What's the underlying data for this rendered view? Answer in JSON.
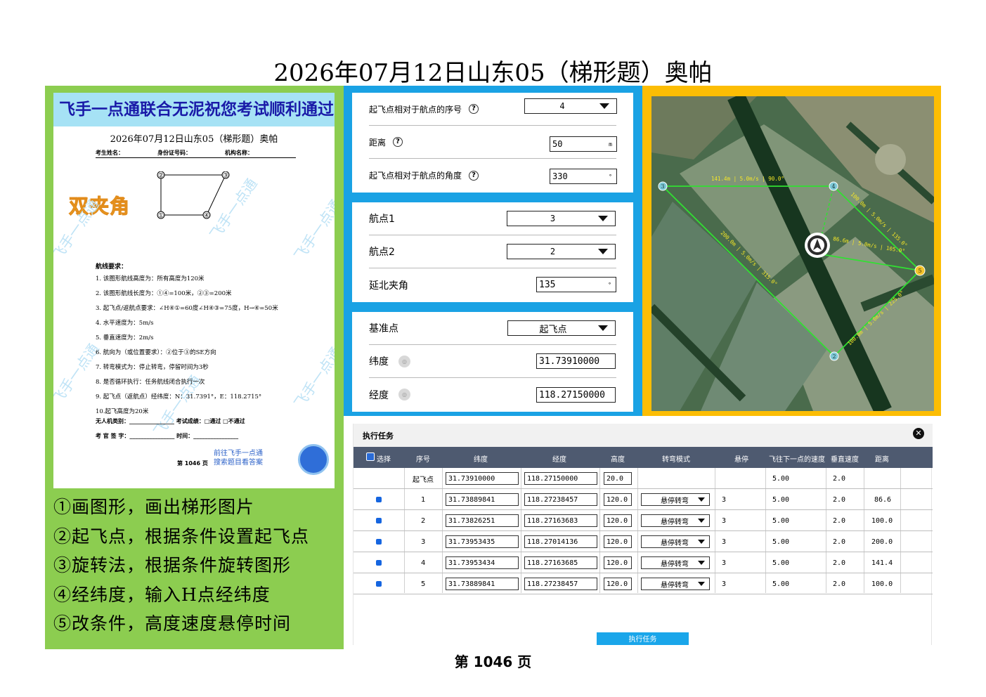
{
  "page_title": "2026年07月12日山东05（梯形题）奥帕",
  "exam_sheet": {
    "banner": "飞手一点通联合无泥祝您考试顺利通过",
    "title": "2026年07月12日山东05（梯形题）奥帕",
    "fields": [
      "考生姓名：",
      "身份证号码：",
      "机构名称："
    ],
    "shape_points": [
      "①",
      "②",
      "③",
      "④"
    ],
    "stamp": "双夹角",
    "watermark": "飞手一点通",
    "requirements_heading": "航线要求：",
    "requirements": [
      "1.  该图形航线高度为：所有高度为120米",
      "2.  该图形航线长度为：①④=100米，②③=200米",
      "3.  起飞点/返航点要求：∠H④①=60度∠H④③=75度，H→④=50米",
      "4.  水平速度为：5m/s",
      "5.  垂直速度为：2m/s",
      "6.  航向为（或位置要求）：②位于③的SE方向",
      "7.  转弯模式为：停止转弯，停留时间为3秒",
      "8.  是否循环执行：任务航线闭合执行一次",
      "9.  起飞点（返航点）经纬度：N：31.7391°，E：118.2715°",
      "10.起飞高度为20米"
    ],
    "footer_line1": "无人机类别：________________    考试成绩：□通过  □不通过",
    "footer_line2": "考  官  签  字：________________    时间：________________",
    "page_ref": "第  1046  页",
    "goto_line1": "前往飞手一点通",
    "goto_line2": "搜索题目看答案"
  },
  "steps": [
    "①画图形，画出梯形图片",
    "②起飞点，根据条件设置起飞点",
    "③旋转法，根据条件旋转图形",
    "④经纬度，输入H点经纬度",
    "⑤改条件，高度速度悬停时间"
  ],
  "settings": {
    "box1": {
      "seq_label": "起飞点相对于航点的序号",
      "seq_value": "4",
      "dist_label": "距离",
      "dist_value": "50",
      "dist_unit": "m",
      "angle_label": "起飞点相对于航点的角度",
      "angle_value": "330",
      "angle_unit": "°"
    },
    "box2": {
      "wp1_label": "航点1",
      "wp1_value": "3",
      "wp2_label": "航点2",
      "wp2_value": "2",
      "north_label": "延北夹角",
      "north_value": "135",
      "north_unit": "°"
    },
    "box3": {
      "ref_label": "基准点",
      "ref_value": "起飞点",
      "lat_label": "纬度",
      "lat_value": "31.73910000",
      "lon_label": "经度",
      "lon_value": "118.27150000"
    }
  },
  "map": {
    "waypoints": [
      "1",
      "2",
      "3",
      "4",
      "5"
    ],
    "segment_labels": [
      "141.4m | 5.0m/s | 90.0°",
      "100.0m | 5.0m/s | 135.0°",
      "86.6m | 5.0m/s | 105.0°",
      "100.0m | 5.0m/s | 225.0°",
      "200.0m | 5.0m/s | 315.0°"
    ],
    "colors": {
      "route": "#31e032",
      "label": "#f5e627",
      "waypoint": "#7ec9d6",
      "waypoint_5": "#f2c32b"
    }
  },
  "task": {
    "title": "执行任务",
    "headers": [
      "选择",
      "序号",
      "纬度",
      "经度",
      "高度",
      "转弯模式",
      "悬停",
      "飞往下一点的速度",
      "垂直速度",
      "距离"
    ],
    "takeoff_row": {
      "seq": "起飞点",
      "lat": "31.73910000",
      "lon": "118.27150000",
      "alt": "20.0",
      "speed": "5.00",
      "vspeed": "2.0"
    },
    "rows": [
      {
        "seq": "1",
        "lat": "31.73889841",
        "lon": "118.27238457",
        "alt": "120.0",
        "turn": "悬停转弯",
        "hover": "3",
        "speed": "5.00",
        "vspeed": "2.0",
        "dist": "86.6"
      },
      {
        "seq": "2",
        "lat": "31.73826251",
        "lon": "118.27163683",
        "alt": "120.0",
        "turn": "悬停转弯",
        "hover": "3",
        "speed": "5.00",
        "vspeed": "2.0",
        "dist": "100.0"
      },
      {
        "seq": "3",
        "lat": "31.73953435",
        "lon": "118.27014136",
        "alt": "120.0",
        "turn": "悬停转弯",
        "hover": "3",
        "speed": "5.00",
        "vspeed": "2.0",
        "dist": "200.0"
      },
      {
        "seq": "4",
        "lat": "31.73953434",
        "lon": "118.27163685",
        "alt": "120.0",
        "turn": "悬停转弯",
        "hover": "3",
        "speed": "5.00",
        "vspeed": "2.0",
        "dist": "141.4"
      },
      {
        "seq": "5",
        "lat": "31.73889841",
        "lon": "118.27238457",
        "alt": "120.0",
        "turn": "悬停转弯",
        "hover": "3",
        "speed": "5.00",
        "vspeed": "2.0",
        "dist": "100.0"
      }
    ],
    "exec_button": "执行任务"
  },
  "page_number": "第  1046  页",
  "colors": {
    "green_panel": "#8ccd50",
    "blue_panel": "#1aa2e4",
    "orange_panel": "#fcbd04",
    "table_header": "#4e5a70"
  }
}
